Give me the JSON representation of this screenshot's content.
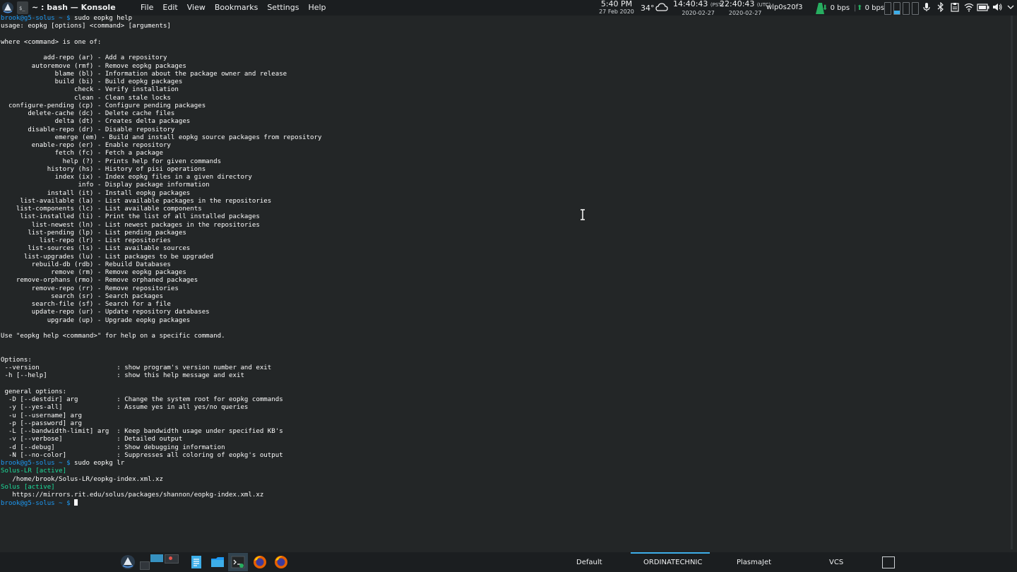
{
  "top_panel": {
    "window_title": "~ : bash — Konsole",
    "konsole_icon_text": "$_",
    "menu": [
      "File",
      "Edit",
      "View",
      "Bookmarks",
      "Settings",
      "Help"
    ],
    "clock_time": "5:40 PM",
    "clock_date": "27 Feb 2020",
    "temperature": "34°",
    "tz1_time": "14:40:43",
    "tz1_label": "(PST)",
    "tz1_date": "2020-02-27",
    "tz2_time": "22:40:43",
    "tz2_label": "(UTC)",
    "tz2_date": "2020-02-27",
    "network_interface": "wlp0s20f3",
    "download_rate": "0 bps",
    "upload_rate": "0 bps",
    "cpu_bar_levels": [
      0,
      0.3,
      0,
      0
    ],
    "tray_icons": [
      "microphone-icon",
      "bluetooth-icon",
      "clipboard-icon",
      "wifi-icon",
      "battery-icon",
      "volume-icon"
    ],
    "accent_color": "#3daee9",
    "graph_color": "#27ae60"
  },
  "terminal": {
    "prompt_user": "brook@g5-solus",
    "prompt_sep": " ~ $ ",
    "lines": [
      {
        "type": "cmd",
        "text": "sudo eopkg help"
      },
      {
        "type": "out",
        "text": "usage: eopkg [options] <command> [arguments]"
      },
      {
        "type": "out",
        "text": ""
      },
      {
        "type": "out",
        "text": "where <command> is one of:"
      },
      {
        "type": "out",
        "text": ""
      },
      {
        "type": "out",
        "text": "           add-repo (ar) - Add a repository"
      },
      {
        "type": "out",
        "text": "        autoremove (rmf) - Remove eopkg packages"
      },
      {
        "type": "out",
        "text": "              blame (bl) - Information about the package owner and release"
      },
      {
        "type": "out",
        "text": "              build (bi) - Build eopkg packages"
      },
      {
        "type": "out",
        "text": "                   check - Verify installation"
      },
      {
        "type": "out",
        "text": "                   clean - Clean stale locks"
      },
      {
        "type": "out",
        "text": "  configure-pending (cp) - Configure pending packages"
      },
      {
        "type": "out",
        "text": "       delete-cache (dc) - Delete cache files"
      },
      {
        "type": "out",
        "text": "              delta (dt) - Creates delta packages"
      },
      {
        "type": "out",
        "text": "       disable-repo (dr) - Disable repository"
      },
      {
        "type": "out",
        "text": "              emerge (em) - Build and install eopkg source packages from repository"
      },
      {
        "type": "out",
        "text": "        enable-repo (er) - Enable repository"
      },
      {
        "type": "out",
        "text": "              fetch (fc) - Fetch a package"
      },
      {
        "type": "out",
        "text": "                help (?) - Prints help for given commands"
      },
      {
        "type": "out",
        "text": "            history (hs) - History of pisi operations"
      },
      {
        "type": "out",
        "text": "              index (ix) - Index eopkg files in a given directory"
      },
      {
        "type": "out",
        "text": "                    info - Display package information"
      },
      {
        "type": "out",
        "text": "            install (it) - Install eopkg packages"
      },
      {
        "type": "out",
        "text": "     list-available (la) - List available packages in the repositories"
      },
      {
        "type": "out",
        "text": "    list-components (lc) - List available components"
      },
      {
        "type": "out",
        "text": "     list-installed (li) - Print the list of all installed packages"
      },
      {
        "type": "out",
        "text": "        list-newest (ln) - List newest packages in the repositories"
      },
      {
        "type": "out",
        "text": "       list-pending (lp) - List pending packages"
      },
      {
        "type": "out",
        "text": "          list-repo (lr) - List repositories"
      },
      {
        "type": "out",
        "text": "       list-sources (ls) - List available sources"
      },
      {
        "type": "out",
        "text": "      list-upgrades (lu) - List packages to be upgraded"
      },
      {
        "type": "out",
        "text": "        rebuild-db (rdb) - Rebuild Databases"
      },
      {
        "type": "out",
        "text": "             remove (rm) - Remove eopkg packages"
      },
      {
        "type": "out",
        "text": "    remove-orphans (rmo) - Remove orphaned packages"
      },
      {
        "type": "out",
        "text": "        remove-repo (rr) - Remove repositories"
      },
      {
        "type": "out",
        "text": "             search (sr) - Search packages"
      },
      {
        "type": "out",
        "text": "        search-file (sf) - Search for a file"
      },
      {
        "type": "out",
        "text": "        update-repo (ur) - Update repository databases"
      },
      {
        "type": "out",
        "text": "            upgrade (up) - Upgrade eopkg packages"
      },
      {
        "type": "out",
        "text": ""
      },
      {
        "type": "out",
        "text": "Use \"eopkg help <command>\" for help on a specific command."
      },
      {
        "type": "out",
        "text": ""
      },
      {
        "type": "out",
        "text": ""
      },
      {
        "type": "out",
        "text": "Options:"
      },
      {
        "type": "out",
        "text": " --version                    : show program's version number and exit"
      },
      {
        "type": "out",
        "text": " -h [--help]                  : show this help message and exit"
      },
      {
        "type": "out",
        "text": ""
      },
      {
        "type": "out",
        "text": " general options:"
      },
      {
        "type": "out",
        "text": "  -D [--destdir] arg          : Change the system root for eopkg commands"
      },
      {
        "type": "out",
        "text": "  -y [--yes-all]              : Assume yes in all yes/no queries"
      },
      {
        "type": "out",
        "text": "  -u [--username] arg"
      },
      {
        "type": "out",
        "text": "  -p [--password] arg"
      },
      {
        "type": "out",
        "text": "  -L [--bandwidth-limit] arg  : Keep bandwidth usage under specified KB's"
      },
      {
        "type": "out",
        "text": "  -v [--verbose]              : Detailed output"
      },
      {
        "type": "out",
        "text": "  -d [--debug]                : Show debugging information"
      },
      {
        "type": "out",
        "text": "  -N [--no-color]             : Suppresses all coloring of eopkg's output"
      },
      {
        "type": "cmd",
        "text": "sudo eopkg lr"
      },
      {
        "type": "active",
        "text": "Solus-LR [active]"
      },
      {
        "type": "out",
        "text": "   /home/brook/Solus-LR/eopkg-index.xml.xz"
      },
      {
        "type": "active",
        "text": "Solus [active]"
      },
      {
        "type": "out",
        "text": "   https://mirrors.rit.edu/solus/packages/shannon/eopkg-index.xml.xz"
      },
      {
        "type": "prompt",
        "text": ""
      }
    ]
  },
  "bottom_panel": {
    "taskbar_items": [
      {
        "name": "app-launcher-icon"
      },
      {
        "name": "pager-icon"
      },
      {
        "name": "text-editor-icon"
      },
      {
        "name": "file-manager-icon"
      },
      {
        "name": "konsole-task-icon"
      },
      {
        "name": "firefox-icon"
      },
      {
        "name": "firefox-icon-2"
      }
    ],
    "activities": [
      "Default",
      "ORDINATECHNIC",
      "PlasmaJet",
      "VCS"
    ],
    "active_activity": "ORDINATECHNIC"
  }
}
